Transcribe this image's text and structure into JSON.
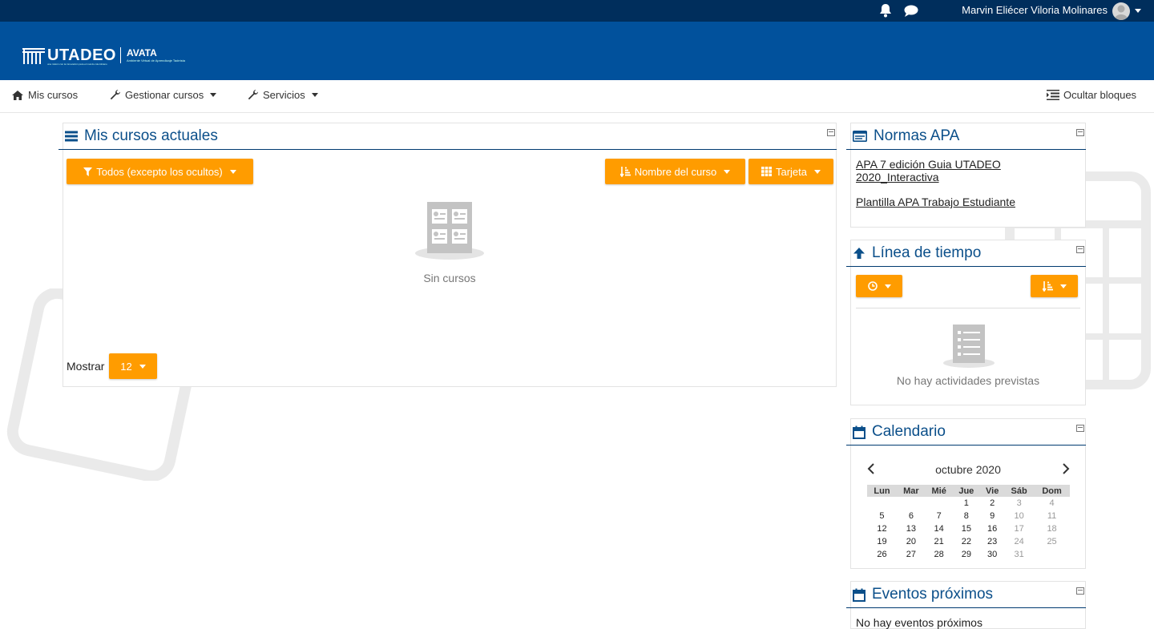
{
  "topbar": {
    "user_name": "Marvin Eliécer Viloria Molinares",
    "icons": [
      "bell-icon",
      "chat-icon"
    ]
  },
  "banner": {
    "brand": "UTADEO",
    "brand_tagline": "una misión con la innovación para el mundo colombiano",
    "platform": "AVATA",
    "platform_sub": "Ambiente Virtual de Aprendizaje Tadeísta"
  },
  "nav": {
    "mis_cursos": "Mis cursos",
    "gestionar": "Gestionar cursos",
    "servicios": "Servicios",
    "ocultar": "Ocultar bloques"
  },
  "cursos": {
    "title": "Mis cursos actuales",
    "filter_label": "Todos (excepto los ocultos)",
    "sort_label": "Nombre del curso",
    "view_label": "Tarjeta",
    "empty_label": "Sin cursos",
    "show_label": "Mostrar",
    "show_value": "12"
  },
  "normas": {
    "title": "Normas APA",
    "link1_line1": "APA 7 edición Guia UTADEO",
    "link1_line2": "2020_Interactiva",
    "link2": "Plantilla APA Trabajo Estudiante"
  },
  "timeline": {
    "title": "Línea de tiempo",
    "empty_label": "No hay actividades previstas"
  },
  "calendar": {
    "title": "Calendario",
    "month": "octubre 2020",
    "weekdays": [
      "Lun",
      "Mar",
      "Mié",
      "Jue",
      "Vie",
      "Sáb",
      "Dom"
    ],
    "weeks": [
      [
        "",
        "",
        "",
        "1",
        "2",
        "3",
        "4"
      ],
      [
        "5",
        "6",
        "7",
        "8",
        "9",
        "10",
        "11"
      ],
      [
        "12",
        "13",
        "14",
        "15",
        "16",
        "17",
        "18"
      ],
      [
        "19",
        "20",
        "21",
        "22",
        "23",
        "24",
        "25"
      ],
      [
        "26",
        "27",
        "28",
        "29",
        "30",
        "31",
        ""
      ]
    ]
  },
  "eventos": {
    "title": "Eventos próximos",
    "empty_label": "No hay eventos próximos"
  },
  "colors": {
    "topbar": "#002e5c",
    "banner": "#01519c",
    "accent": "#ff9c00",
    "title": "#0b4f8a"
  }
}
